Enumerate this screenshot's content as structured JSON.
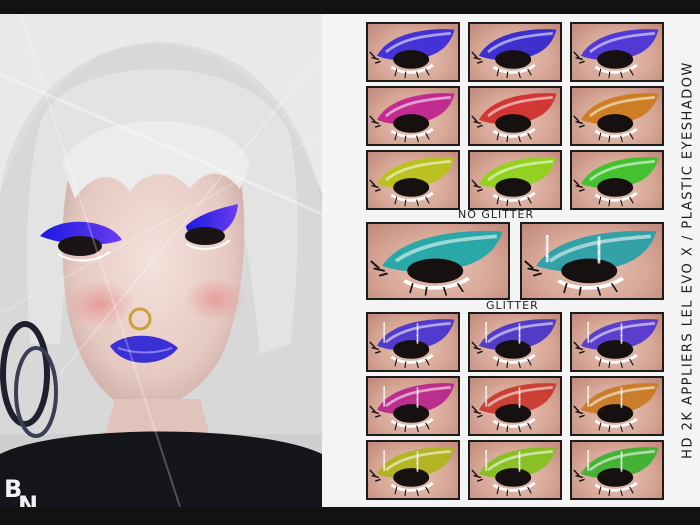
{
  "title": "HD 2K APPLIERS  LEL EVO X / PLASTIC EYESHADOW",
  "logo": {
    "letter_top": "B",
    "letter_bottom": "N"
  },
  "labels": {
    "no_glitter": "NO GLITTER",
    "glitter": "GLITTER"
  },
  "colors": {
    "background": "#101010",
    "panel": "#f4f4f4",
    "skin": "#d8a898",
    "lips": "#3b2fd6"
  },
  "sections": {
    "no_glitter_grid": {
      "finish": "no-glitter",
      "swatches": [
        {
          "color": "#3b2bd9"
        },
        {
          "color": "#3528d2"
        },
        {
          "color": "#4a33d8"
        },
        {
          "color": "#c0258f"
        },
        {
          "color": "#d0302e"
        },
        {
          "color": "#cc7a1c"
        },
        {
          "color": "#b8c21a"
        },
        {
          "color": "#8fd21a"
        },
        {
          "color": "#3cc22a"
        }
      ]
    },
    "teal_pair": {
      "swatches": [
        {
          "color": "#1fa8a8"
        },
        {
          "color": "#2aa0a8"
        }
      ]
    },
    "glitter_grid": {
      "finish": "glitter",
      "swatches": [
        {
          "color": "#4a34cf"
        },
        {
          "color": "#4a36c8"
        },
        {
          "color": "#5438d0"
        },
        {
          "color": "#b8288a"
        },
        {
          "color": "#c83a2e"
        },
        {
          "color": "#c87a24"
        },
        {
          "color": "#b0b41e"
        },
        {
          "color": "#86c020"
        },
        {
          "color": "#3cb22e"
        }
      ]
    }
  }
}
